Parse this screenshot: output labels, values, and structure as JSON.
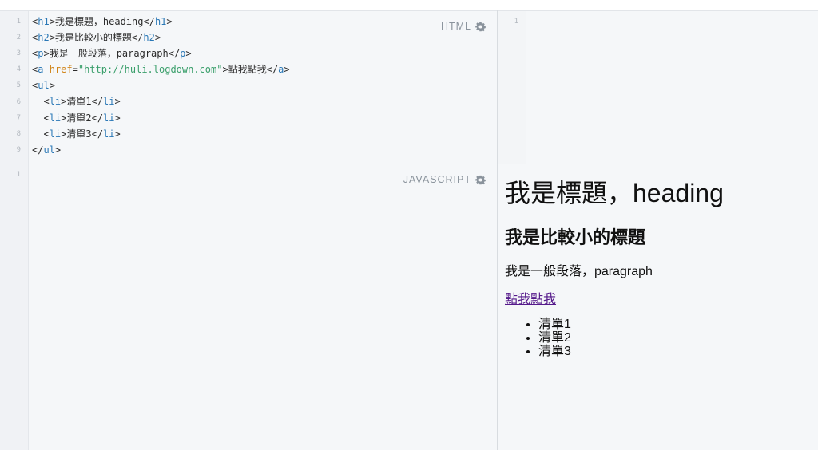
{
  "panes": {
    "html": {
      "label": "HTML",
      "line_numbers": [
        "1",
        "2",
        "3",
        "4",
        "5",
        "6",
        "7",
        "8",
        "9"
      ],
      "lines": [
        [
          {
            "t": "<",
            "c": "plain"
          },
          {
            "t": "h1",
            "c": "tag"
          },
          {
            "t": ">我是標題，heading</",
            "c": "plain"
          },
          {
            "t": "h1",
            "c": "tag"
          },
          {
            "t": ">",
            "c": "plain"
          }
        ],
        [
          {
            "t": "<",
            "c": "plain"
          },
          {
            "t": "h2",
            "c": "tag"
          },
          {
            "t": ">我是比較小的標題</",
            "c": "plain"
          },
          {
            "t": "h2",
            "c": "tag"
          },
          {
            "t": ">",
            "c": "plain"
          }
        ],
        [
          {
            "t": "<",
            "c": "plain"
          },
          {
            "t": "p",
            "c": "tag"
          },
          {
            "t": ">我是一般段落，paragraph</",
            "c": "plain"
          },
          {
            "t": "p",
            "c": "tag"
          },
          {
            "t": ">",
            "c": "plain"
          }
        ],
        [
          {
            "t": "<",
            "c": "plain"
          },
          {
            "t": "a",
            "c": "tag"
          },
          {
            "t": " ",
            "c": "plain"
          },
          {
            "t": "href",
            "c": "attr"
          },
          {
            "t": "=",
            "c": "plain"
          },
          {
            "t": "\"http://huli.logdown.com\"",
            "c": "str"
          },
          {
            "t": ">點我點我</",
            "c": "plain"
          },
          {
            "t": "a",
            "c": "tag"
          },
          {
            "t": ">",
            "c": "plain"
          }
        ],
        [
          {
            "t": "<",
            "c": "plain"
          },
          {
            "t": "ul",
            "c": "tag"
          },
          {
            "t": ">",
            "c": "plain"
          }
        ],
        [
          {
            "t": "  <",
            "c": "plain"
          },
          {
            "t": "li",
            "c": "tag"
          },
          {
            "t": ">清單1</",
            "c": "plain"
          },
          {
            "t": "li",
            "c": "tag"
          },
          {
            "t": ">",
            "c": "plain"
          }
        ],
        [
          {
            "t": "  <",
            "c": "plain"
          },
          {
            "t": "li",
            "c": "tag"
          },
          {
            "t": ">清單2</",
            "c": "plain"
          },
          {
            "t": "li",
            "c": "tag"
          },
          {
            "t": ">",
            "c": "plain"
          }
        ],
        [
          {
            "t": "  <",
            "c": "plain"
          },
          {
            "t": "li",
            "c": "tag"
          },
          {
            "t": ">清單3</",
            "c": "plain"
          },
          {
            "t": "li",
            "c": "tag"
          },
          {
            "t": ">",
            "c": "plain"
          }
        ],
        [
          {
            "t": "</",
            "c": "plain"
          },
          {
            "t": "ul",
            "c": "tag"
          },
          {
            "t": ">",
            "c": "plain"
          }
        ]
      ]
    },
    "css": {
      "line_numbers": [
        "1"
      ]
    },
    "javascript": {
      "label": "JAVASCRIPT",
      "line_numbers": [
        "1"
      ]
    }
  },
  "output": {
    "h1": "我是標題，heading",
    "h2": "我是比較小的標題",
    "p": "我是一般段落，paragraph",
    "link": "點我點我",
    "list": [
      "清單1",
      "清單2",
      "清單3"
    ]
  },
  "colors": {
    "tag": "#2a78b6",
    "attr": "#d1861b",
    "string": "#3a9f6b",
    "visited_link": "#551a8b",
    "pane_bg": "#f5f7f9"
  },
  "icons": {
    "settings": "gear-icon"
  }
}
